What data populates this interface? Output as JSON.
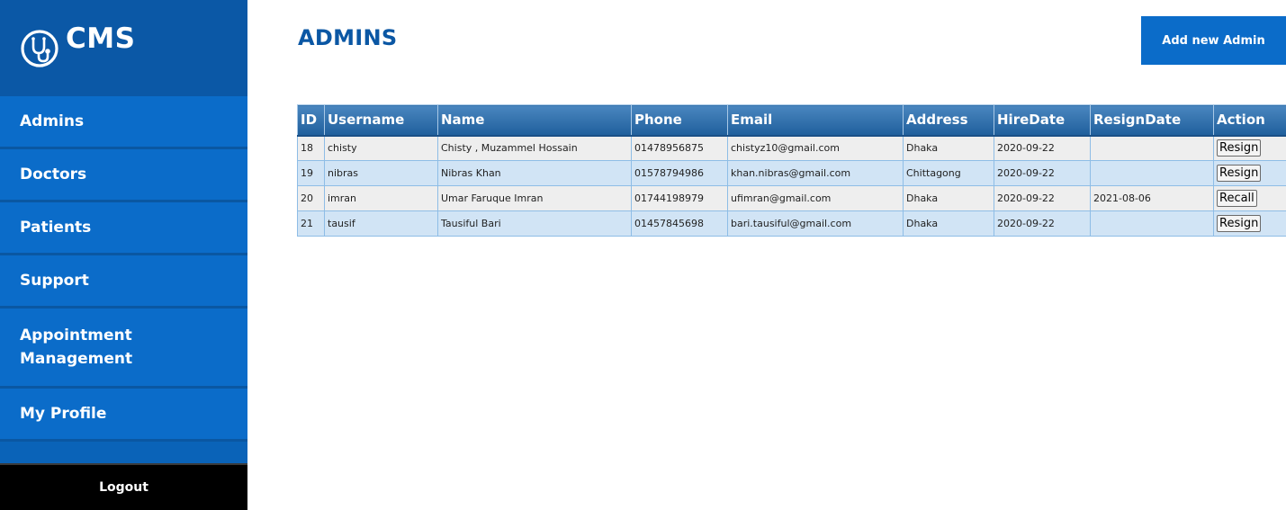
{
  "brand": {
    "name": "CMS"
  },
  "sidebar": {
    "items": [
      {
        "label": "Admins"
      },
      {
        "label": "Doctors"
      },
      {
        "label": "Patients"
      },
      {
        "label": "Support"
      },
      {
        "label": "Appointment Management"
      },
      {
        "label": "My Profile"
      }
    ],
    "logout": "Logout"
  },
  "page": {
    "title": "ADMINS",
    "add_button": "Add new Admin"
  },
  "table": {
    "headers": [
      "ID",
      "Username",
      "Name",
      "Phone",
      "Email",
      "Address",
      "HireDate",
      "ResignDate",
      "Action"
    ],
    "rows": [
      {
        "id": "18",
        "username": "chisty",
        "name": "Chisty , Muzammel Hossain",
        "phone": "01478956875",
        "email": "chistyz10@gmail.com",
        "address": "Dhaka",
        "hire_date": "2020-09-22",
        "resign_date": "",
        "action": "Resign"
      },
      {
        "id": "19",
        "username": "nibras",
        "name": "Nibras Khan",
        "phone": "01578794986",
        "email": "khan.nibras@gmail.com",
        "address": "Chittagong",
        "hire_date": "2020-09-22",
        "resign_date": "",
        "action": "Resign"
      },
      {
        "id": "20",
        "username": "imran",
        "name": "Umar Faruque Imran",
        "phone": "01744198979",
        "email": "ufimran@gmail.com",
        "address": "Dhaka",
        "hire_date": "2020-09-22",
        "resign_date": "2021-08-06",
        "action": "Recall"
      },
      {
        "id": "21",
        "username": "tausif",
        "name": "Tausiful Bari",
        "phone": "01457845698",
        "email": "bari.tausiful@gmail.com",
        "address": "Dhaka",
        "hire_date": "2020-09-22",
        "resign_date": "",
        "action": "Resign"
      }
    ]
  },
  "colors": {
    "sidebar": "#0b6cc9",
    "brand_bar": "#0b58a6",
    "title": "#0b57a4",
    "header_gradient_top": "#4a86bf",
    "header_gradient_bottom": "#1f5f9c",
    "row_odd": "#eeeeee",
    "row_even": "#d1e4f5",
    "logout_bg": "#000000"
  },
  "icons": {
    "logo": "stethoscope-icon"
  }
}
